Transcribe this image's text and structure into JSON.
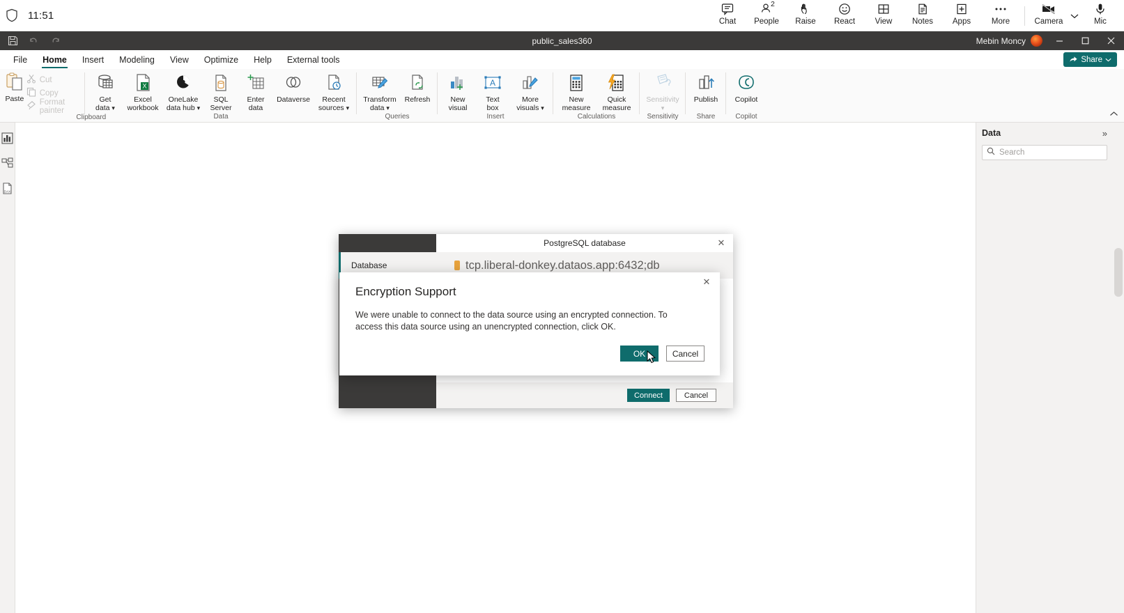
{
  "teams": {
    "clock": "11:51",
    "shield_icon": "shield-icon",
    "items": [
      {
        "label": "Chat",
        "icon": "chat-icon",
        "badge": ""
      },
      {
        "label": "People",
        "icon": "people-icon",
        "badge": "2"
      },
      {
        "label": "Raise",
        "icon": "raise-hand-icon",
        "badge": ""
      },
      {
        "label": "React",
        "icon": "react-smiley-icon",
        "badge": ""
      },
      {
        "label": "View",
        "icon": "view-grid-icon",
        "badge": ""
      },
      {
        "label": "Notes",
        "icon": "notes-icon",
        "badge": ""
      },
      {
        "label": "Apps",
        "icon": "apps-plus-icon",
        "badge": ""
      },
      {
        "label": "More",
        "icon": "more-ellipsis-icon",
        "badge": ""
      }
    ],
    "camera": {
      "label": "Camera",
      "icon": "camera-off-icon"
    },
    "mic": {
      "label": "Mic",
      "icon": "microphone-icon"
    }
  },
  "titlebar": {
    "title": "public_sales360",
    "account_name": "Mebin Moncy",
    "quick_access": [
      {
        "name": "save-icon",
        "glyph": "save"
      },
      {
        "name": "undo-icon",
        "glyph": "undo"
      },
      {
        "name": "redo-icon",
        "glyph": "redo"
      }
    ],
    "window_buttons": [
      {
        "name": "minimize-button",
        "glyph": "minimize"
      },
      {
        "name": "maximize-button",
        "glyph": "maximize"
      },
      {
        "name": "close-button",
        "glyph": "close"
      }
    ]
  },
  "ribbon": {
    "tabs": [
      {
        "label": "File",
        "active": false
      },
      {
        "label": "Home",
        "active": true
      },
      {
        "label": "Insert",
        "active": false
      },
      {
        "label": "Modeling",
        "active": false
      },
      {
        "label": "View",
        "active": false
      },
      {
        "label": "Optimize",
        "active": false
      },
      {
        "label": "Help",
        "active": false
      },
      {
        "label": "External tools",
        "active": false
      }
    ],
    "share_label": "Share",
    "clipboard": {
      "group_label": "Clipboard",
      "paste_label": "Paste",
      "cut_label": "Cut",
      "copy_label": "Copy",
      "format_painter_label": "Format painter"
    },
    "groups": [
      {
        "label": "Data",
        "items": [
          {
            "label": "Get\ndata",
            "name": "get-data-button",
            "caret": true
          },
          {
            "label": "Excel\nworkbook",
            "name": "excel-workbook-button",
            "caret": false
          },
          {
            "label": "OneLake\ndata hub",
            "name": "onelake-data-hub-button",
            "caret": true
          },
          {
            "label": "SQL\nServer",
            "name": "sql-server-button",
            "caret": false
          },
          {
            "label": "Enter\ndata",
            "name": "enter-data-button",
            "caret": false
          },
          {
            "label": "Dataverse",
            "name": "dataverse-button",
            "caret": false
          },
          {
            "label": "Recent\nsources",
            "name": "recent-sources-button",
            "caret": true
          }
        ]
      },
      {
        "label": "Queries",
        "items": [
          {
            "label": "Transform\ndata",
            "name": "transform-data-button",
            "caret": true
          },
          {
            "label": "Refresh",
            "name": "refresh-button",
            "caret": false
          }
        ]
      },
      {
        "label": "Insert",
        "items": [
          {
            "label": "New\nvisual",
            "name": "new-visual-button",
            "caret": false
          },
          {
            "label": "Text\nbox",
            "name": "text-box-button",
            "caret": false
          },
          {
            "label": "More\nvisuals",
            "name": "more-visuals-button",
            "caret": true
          }
        ]
      },
      {
        "label": "Calculations",
        "items": [
          {
            "label": "New\nmeasure",
            "name": "new-measure-button",
            "caret": false
          },
          {
            "label": "Quick\nmeasure",
            "name": "quick-measure-button",
            "caret": false
          }
        ]
      },
      {
        "label": "Sensitivity",
        "items": [
          {
            "label": "Sensitivity",
            "name": "sensitivity-button",
            "caret": true,
            "disabled": true
          }
        ]
      },
      {
        "label": "Share",
        "items": [
          {
            "label": "Publish",
            "name": "publish-button",
            "caret": false
          }
        ]
      },
      {
        "label": "Copilot",
        "items": [
          {
            "label": "Copilot",
            "name": "copilot-button",
            "caret": false
          }
        ]
      }
    ]
  },
  "left_rail": [
    {
      "name": "report-view-icon",
      "label": "Report view"
    },
    {
      "name": "model-view-icon",
      "label": "Model view"
    },
    {
      "name": "dax-query-view-icon",
      "label": "DAX query view"
    }
  ],
  "data_pane": {
    "title": "Data",
    "expand_glyph": "»",
    "search_placeholder": "Search"
  },
  "pg_dialog": {
    "title": "PostgreSQL database",
    "sidebar_tab": "Database",
    "server_value": "tcp.liberal-donkey.dataos.app:6432;db",
    "connect_label": "Connect",
    "cancel_label": "Cancel",
    "close_glyph": "✕"
  },
  "encryption_dialog": {
    "title": "Encryption Support",
    "message": "We were unable to connect to the data source using an encrypted connection. To access this data source using an unencrypted connection, click OK.",
    "ok_label": "OK",
    "cancel_label": "Cancel",
    "close_glyph": "✕"
  },
  "colors": {
    "accent_teal": "#0f6c6c",
    "titlebar_dark": "#3b3a39",
    "pane_gray": "#f3f2f1",
    "db_amber": "#e8a33d"
  }
}
